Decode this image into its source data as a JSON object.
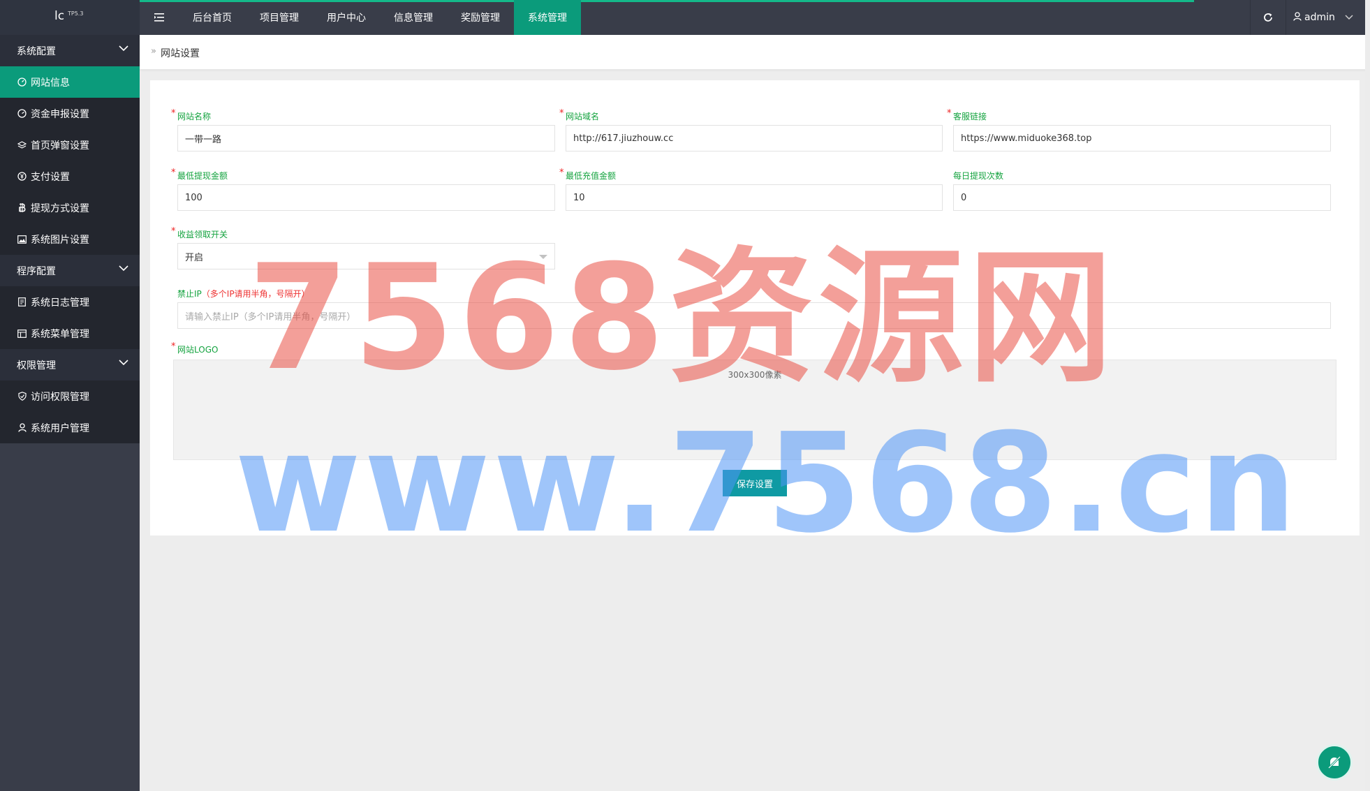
{
  "app": {
    "logo_text": "lc",
    "logo_version": "TP5.3"
  },
  "topnav": {
    "menu_icon": "hamburger-icon",
    "items": [
      {
        "label": "后台首页"
      },
      {
        "label": "项目管理"
      },
      {
        "label": "用户中心"
      },
      {
        "label": "信息管理"
      },
      {
        "label": "奖励管理"
      },
      {
        "label": "系统管理",
        "active": true
      }
    ],
    "refresh_icon": "refresh-icon",
    "user_icon": "user-icon",
    "username": "admin"
  },
  "sidebar": {
    "groups": [
      {
        "label": "系统配置",
        "items": [
          {
            "label": "网站信息",
            "icon": "dashboard-icon",
            "active": true
          },
          {
            "label": "资金申报设置",
            "icon": "gauge-icon"
          },
          {
            "label": "首页弹窗设置",
            "icon": "layers-icon"
          },
          {
            "label": "支付设置",
            "icon": "yen-icon"
          },
          {
            "label": "提现方式设置",
            "icon": "bitcoin-icon"
          },
          {
            "label": "系统图片设置",
            "icon": "image-icon"
          }
        ]
      },
      {
        "label": "程序配置",
        "items": [
          {
            "label": "系统日志管理",
            "icon": "log-icon"
          },
          {
            "label": "系统菜单管理",
            "icon": "menu-table-icon"
          }
        ]
      },
      {
        "label": "权限管理",
        "items": [
          {
            "label": "访问权限管理",
            "icon": "shield-icon"
          },
          {
            "label": "系统用户管理",
            "icon": "user-icon"
          }
        ]
      }
    ]
  },
  "breadcrumb": {
    "arrow": "»",
    "current": "网站设置"
  },
  "form": {
    "site_name": {
      "label": "网站名称",
      "value": "一带一路"
    },
    "site_domain": {
      "label": "网站域名",
      "value": "http://617.jiuzhouw.cc"
    },
    "service_link": {
      "label": "客服链接",
      "value": "https://www.miduoke368.top"
    },
    "min_withdraw": {
      "label": "最低提现金额",
      "value": "100"
    },
    "min_recharge": {
      "label": "最低充值金额",
      "value": "10"
    },
    "daily_withdraw_times": {
      "label": "每日提现次数",
      "value": "0"
    },
    "income_switch": {
      "label": "收益领取开关",
      "value": "开启"
    },
    "banned_ip": {
      "label": "禁止IP",
      "label_note": "（多个IP请用半角，号隔开）",
      "placeholder": "请输入禁止IP（多个IP请用半角，号隔开）"
    },
    "site_logo": {
      "label": "网站LOGO",
      "hint": "300x300像素"
    },
    "save_label": "保存设置"
  },
  "watermark": {
    "line1": "7568资源网",
    "line2": "www.7568.cn"
  },
  "colors": {
    "accent": "#0b9b7b",
    "topbar": "#393d49",
    "label_green": "#14a33f",
    "required_red": "#ee2222"
  }
}
